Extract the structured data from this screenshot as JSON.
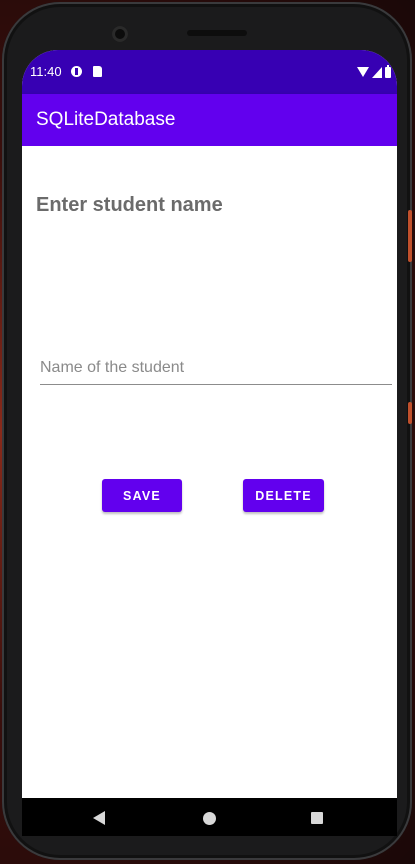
{
  "status_bar": {
    "time": "11:40",
    "icons": [
      "notification-icon",
      "sd-card-icon",
      "wifi-icon",
      "signal-icon",
      "battery-icon"
    ],
    "background": "#3700b3"
  },
  "app_bar": {
    "title": "SQLiteDatabase",
    "background": "#6200ee"
  },
  "main": {
    "heading": "Enter student name",
    "name_input": {
      "value": "",
      "placeholder": "Name of the student"
    },
    "save_label": "SAVE",
    "delete_label": "DELETE",
    "button_color": "#6200ee"
  },
  "nav_bar": {
    "icons": [
      "back-icon",
      "home-icon",
      "recents-icon"
    ]
  }
}
